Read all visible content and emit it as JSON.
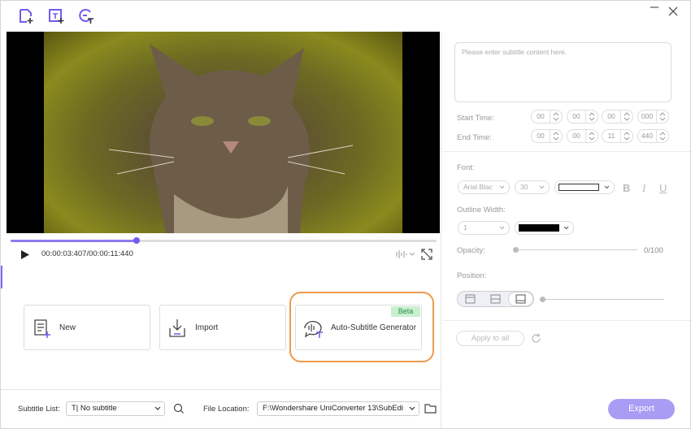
{
  "toolbar": {
    "icons": [
      "add-file-icon",
      "add-subtitle-icon",
      "auto-subtitle-icon"
    ],
    "window_controls": [
      "minimize-icon",
      "close-icon"
    ]
  },
  "player": {
    "timecode": "00:00:03:407/00:00:11:440",
    "progress": 0.295
  },
  "cards": {
    "new_label": "New",
    "import_label": "Import",
    "auto_label": "Auto-Subtitle Generator",
    "beta_badge": "Beta"
  },
  "bottom": {
    "subtitle_list_label": "Subtitle List:",
    "subtitle_list_value": "No subtitle",
    "subtitle_list_prefix": "T|",
    "file_location_label": "File Location:",
    "file_location_value": "F:\\Wondershare UniConverter 13\\SubEdi"
  },
  "editor": {
    "content_placeholder": "Please enter subtitle content here.",
    "start_time_label": "Start Time:",
    "end_time_label": "End Time:",
    "start_time": [
      "00",
      "00",
      "00",
      "000"
    ],
    "end_time": [
      "00",
      "00",
      "11",
      "440"
    ]
  },
  "style": {
    "font_label": "Font:",
    "font_family": "Arial Blac",
    "font_size": "30",
    "font_color": "#ffffff",
    "bold": "B",
    "italic": "I",
    "underline": "U",
    "outline_label": "Outline Width:",
    "outline_width": "1",
    "outline_color": "#000000",
    "opacity_label": "Opacity:",
    "opacity_value": "0/100",
    "position_label": "Position:",
    "position_selected": "bottom",
    "apply_label": "Apply to all"
  },
  "actions": {
    "export_label": "Export"
  },
  "colors": {
    "accent": "#7b6cf0",
    "export_bg": "#a99cf4",
    "highlight": "#ef9a4a",
    "beta_bg": "#c9efcf"
  }
}
